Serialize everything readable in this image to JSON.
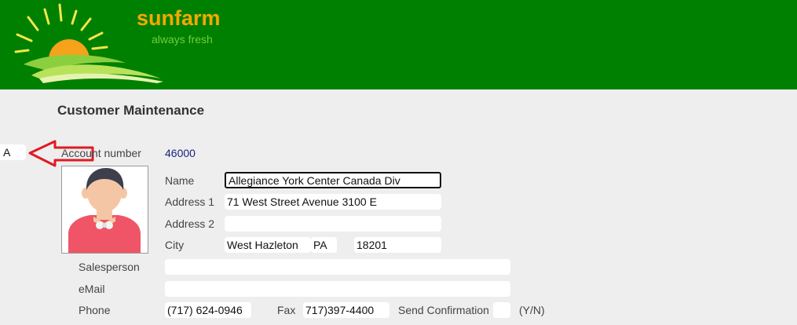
{
  "header": {
    "brand": "sunfarm",
    "tagline": "always fresh",
    "colors": {
      "banner": "#008000",
      "brand": "#f6a800",
      "tagline": "#6fcf3a"
    }
  },
  "page": {
    "title": "Customer Maintenance"
  },
  "left_field": {
    "value": "A"
  },
  "account": {
    "label": "Account number",
    "value": "46000"
  },
  "form": {
    "name_label": "Name",
    "name_value": "Allegiance York Center Canada Div",
    "address1_label": "Address 1",
    "address1_value": "71 West Street Avenue 3100 E",
    "address2_label": "Address 2",
    "address2_value": "",
    "city_label": "City",
    "city_value": "West Hazleton",
    "state_value": "PA",
    "zip_value": "18201",
    "salesperson_label": "Salesperson",
    "salesperson_value": "",
    "email_label": "eMail",
    "email_value": "",
    "phone_label": "Phone",
    "phone_value": "(717) 624-0946",
    "fax_label": "Fax",
    "fax_value": "717)397-4400",
    "confirm_label": "Send Confirmation",
    "confirm_value": "",
    "confirm_hint": "(Y/N)"
  },
  "icons": {
    "logo": "sun-over-field-logo",
    "photo": "customer-avatar-icon",
    "arrow": "red-arrow-left-icon"
  }
}
